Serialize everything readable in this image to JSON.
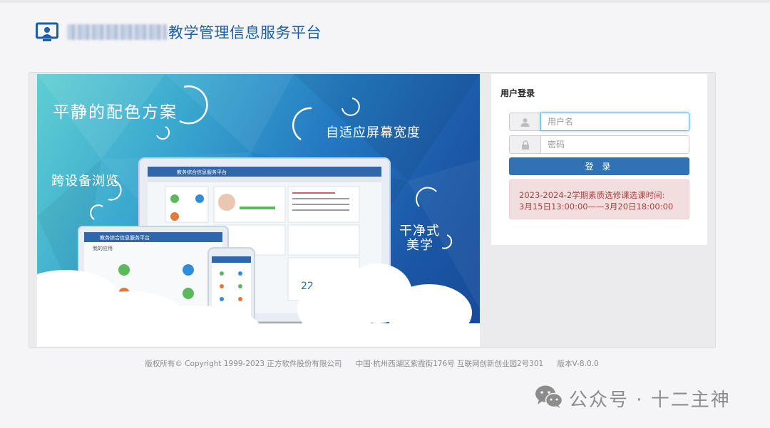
{
  "header": {
    "title": "教学管理信息服务平台"
  },
  "banner": {
    "slogans": [
      "平静的配色方案",
      "自适应屏幕宽度",
      "跨设备浏览",
      "干净式",
      "美学"
    ],
    "device_labels": {
      "desktop_title": "教务综合信息服务平台",
      "tablet_title": "教务综合信息服务平台",
      "tablet_sub": "我的应用",
      "calendar_day": "22"
    }
  },
  "login": {
    "title": "用户登录",
    "username_placeholder": "用户名",
    "password_placeholder": "密码",
    "submit_label": "登 录",
    "notice_line1": "2023-2024-2学期素质选修课选课时间:",
    "notice_line2": "3月15日13:00:00——3月20日18:00:00"
  },
  "footer": {
    "copyright": "版权所有© Copyright 1999-2023 正方软件股份有限公司",
    "address": "中国·杭州西湖区紫霞街176号 互联网创新创业园2号301",
    "version": "版本V-8.0.0"
  },
  "watermark": {
    "text": "公众号 · 十二主神"
  },
  "colors": {
    "brand_blue": "#1b5fa8",
    "button_blue": "#3272b4",
    "notice_bg": "#f2dede",
    "notice_text": "#a94442"
  },
  "icons": [
    "logo-icon",
    "user-icon",
    "lock-icon",
    "wechat-icon"
  ]
}
